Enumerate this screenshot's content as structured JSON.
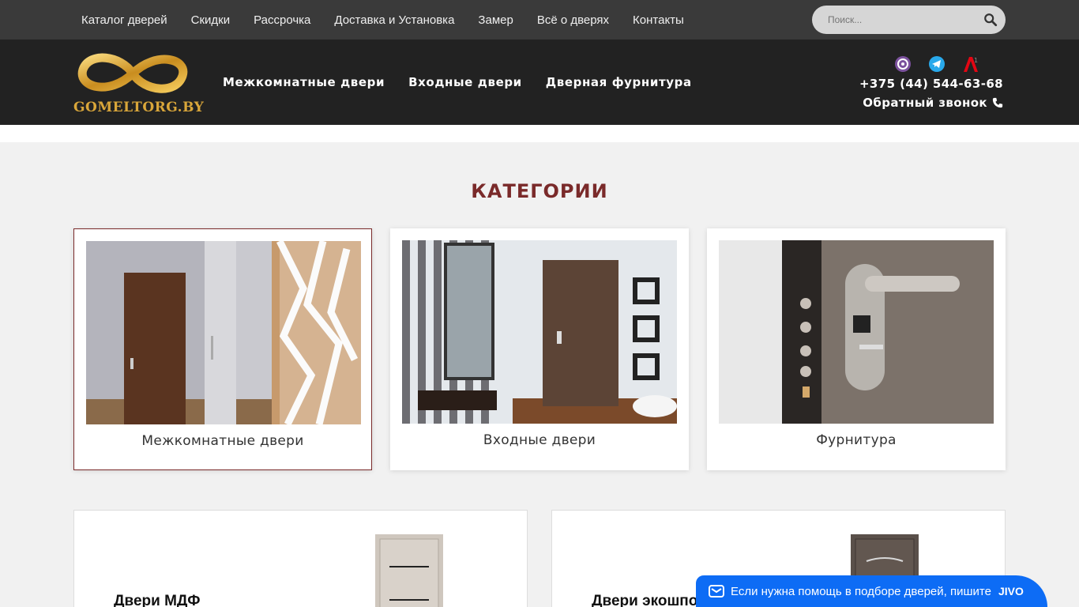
{
  "topnav": {
    "items": [
      "Каталог дверей",
      "Скидки",
      "Рассрочка",
      "Доставка и Установка",
      "Замер",
      "Всё о дверях",
      "Контакты"
    ]
  },
  "search": {
    "placeholder": "Поиск..."
  },
  "header": {
    "logo_text": "GOMELTORG.BY",
    "nav": [
      "Межкомнатные двери",
      "Входные двери",
      "Дверная фурнитура"
    ],
    "social": [
      "viber-icon",
      "telegram-icon",
      "a1-icon"
    ],
    "phone": "+375 (44) 544-63-68",
    "callback": "Обратный звонок"
  },
  "categories": {
    "title": "КАТЕГОРИИ",
    "items": [
      {
        "label": "Межкомнатные двери"
      },
      {
        "label": "Входные двери"
      },
      {
        "label": "Фурнитура"
      }
    ]
  },
  "subcategories": [
    {
      "title": "Двери МДФ"
    },
    {
      "title": "Двери экошпон"
    }
  ],
  "chat": {
    "text": "Если нужна помощь в подборе дверей, пишите",
    "brand": "JIVO"
  },
  "colors": {
    "topbar": "#3a3a3a",
    "header": "#222222",
    "accent": "#7a2a2a",
    "gold": "#d9a63a",
    "chat": "#0d6cf5"
  }
}
